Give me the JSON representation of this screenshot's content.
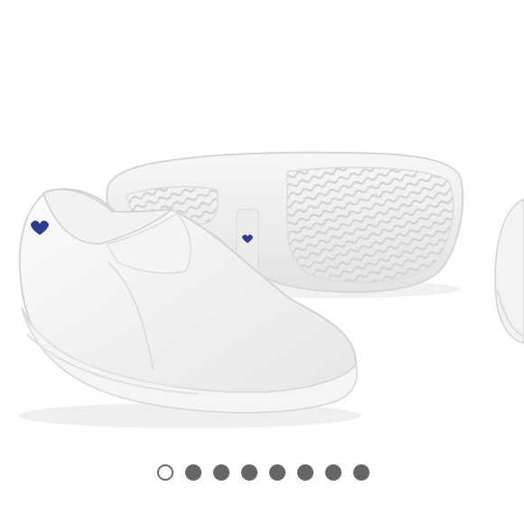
{
  "product_images": {
    "main_image": "white-leather-slip-on-nursing-clogs-pair",
    "next_image": "white-clog-side-view-partial",
    "accent_heart_color": "#2f3b8f"
  },
  "carousel": {
    "dot_count": 8,
    "active_index": 0,
    "active_dot_color": "#ffffff",
    "inactive_dot_color": "#666666"
  }
}
